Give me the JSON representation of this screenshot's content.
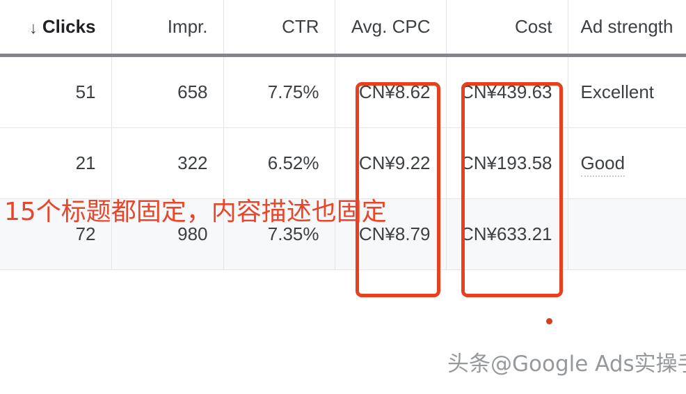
{
  "table": {
    "columns": [
      {
        "key": "clicks",
        "label": "Clicks",
        "sorted": true,
        "sort_icon": "arrow-down-icon",
        "sort_glyph": "↓",
        "align": "right"
      },
      {
        "key": "impr",
        "label": "Impr.",
        "sorted": false,
        "align": "right"
      },
      {
        "key": "ctr",
        "label": "CTR",
        "sorted": false,
        "align": "right"
      },
      {
        "key": "avg_cpc",
        "label": "Avg. CPC",
        "sorted": false,
        "align": "right"
      },
      {
        "key": "cost",
        "label": "Cost",
        "sorted": false,
        "align": "right"
      },
      {
        "key": "strength",
        "label": "Ad strength",
        "sorted": false,
        "align": "left"
      }
    ],
    "rows": [
      {
        "clicks": "51",
        "impr": "658",
        "ctr": "7.75%",
        "avg_cpc": "CN¥8.62",
        "cost": "CN¥439.63",
        "strength": "Excellent",
        "strength_has_tooltip_underline": false,
        "shaded": false
      },
      {
        "clicks": "21",
        "impr": "322",
        "ctr": "6.52%",
        "avg_cpc": "CN¥9.22",
        "cost": "CN¥193.58",
        "strength": "Good",
        "strength_has_tooltip_underline": true,
        "shaded": false
      },
      {
        "clicks": "72",
        "impr": "980",
        "ctr": "7.35%",
        "avg_cpc": "CN¥8.79",
        "cost": "CN¥633.21",
        "strength": "",
        "strength_has_tooltip_underline": false,
        "shaded": true
      }
    ]
  },
  "annotations": {
    "note_text": "15个标题都固定，内容描述也固定",
    "note_color": "#e8452a",
    "highlight_color": "#e8401f",
    "boxes": [
      {
        "name": "avg-cpc-column-highlight",
        "target_column": "Avg. CPC"
      },
      {
        "name": "cost-column-highlight",
        "target_column": "Cost"
      }
    ],
    "dot_color": "#d8401c"
  },
  "watermark": {
    "text": "头条@Google Ads实操手册"
  }
}
